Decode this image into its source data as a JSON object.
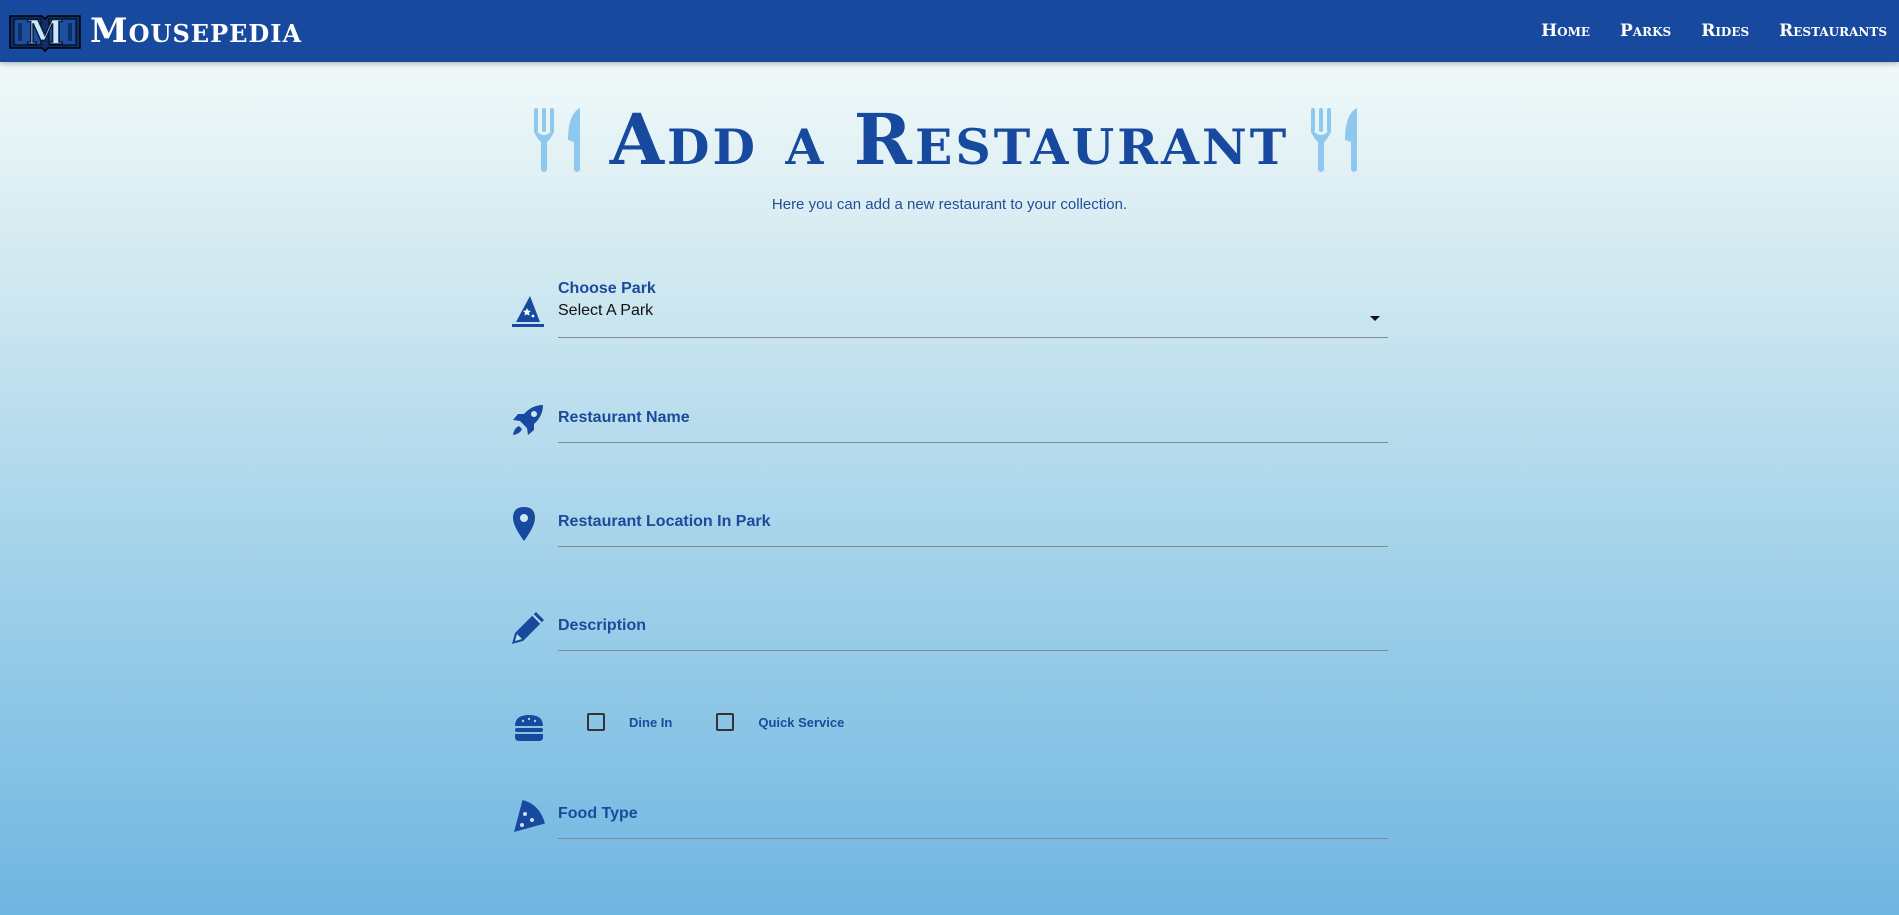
{
  "app": {
    "brand_name": "Mousepedia",
    "logo_letter": "M"
  },
  "nav": {
    "items": [
      {
        "label": "Home"
      },
      {
        "label": "Parks"
      },
      {
        "label": "Rides"
      },
      {
        "label": "Restaurants"
      }
    ]
  },
  "page": {
    "title": "Add a Restaurant",
    "subtitle": "Here you can add a new restaurant to your collection."
  },
  "form": {
    "park": {
      "label": "Choose Park",
      "selected": "Select A Park",
      "icon": "wizard-hat-icon"
    },
    "restaurant_name": {
      "label": "Restaurant Name",
      "icon": "rocket-icon"
    },
    "location": {
      "label": "Restaurant Location In Park",
      "icon": "map-pin-icon"
    },
    "description": {
      "label": "Description",
      "icon": "pencil-icon"
    },
    "service": {
      "icon": "burger-icon",
      "options": [
        {
          "label": "Dine In",
          "checked": false
        },
        {
          "label": "Quick Service",
          "checked": false
        }
      ]
    },
    "food_type": {
      "label": "Food Type",
      "icon": "pizza-icon"
    }
  },
  "colors": {
    "brand": "#174a9e",
    "accent_light": "#8fc8ee",
    "gradient_top": "#f0f9f9",
    "gradient_bottom": "#6fb6e1"
  }
}
